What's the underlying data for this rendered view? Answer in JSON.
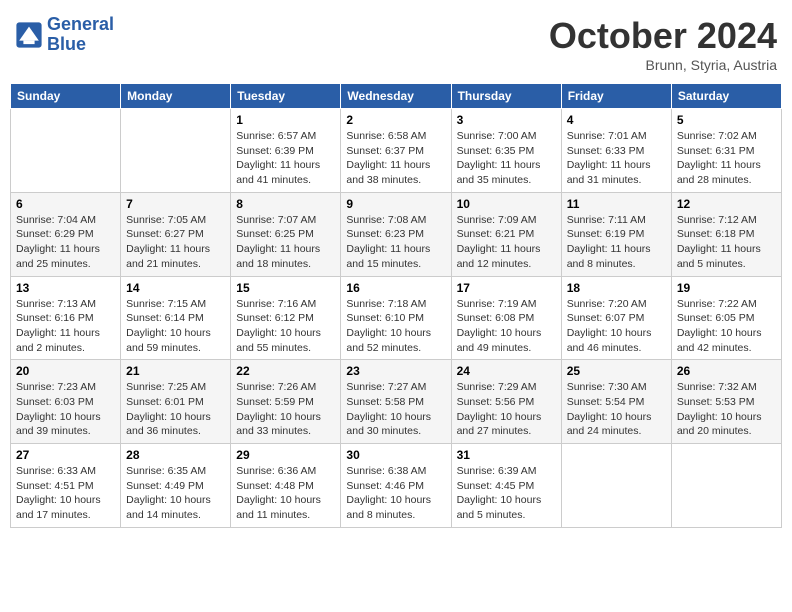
{
  "header": {
    "logo_text_general": "General",
    "logo_text_blue": "Blue",
    "month": "October 2024",
    "location": "Brunn, Styria, Austria"
  },
  "weekdays": [
    "Sunday",
    "Monday",
    "Tuesday",
    "Wednesday",
    "Thursday",
    "Friday",
    "Saturday"
  ],
  "weeks": [
    [
      null,
      null,
      {
        "day": "1",
        "sunrise": "6:57 AM",
        "sunset": "6:39 PM",
        "daylight": "11 hours and 41 minutes."
      },
      {
        "day": "2",
        "sunrise": "6:58 AM",
        "sunset": "6:37 PM",
        "daylight": "11 hours and 38 minutes."
      },
      {
        "day": "3",
        "sunrise": "7:00 AM",
        "sunset": "6:35 PM",
        "daylight": "11 hours and 35 minutes."
      },
      {
        "day": "4",
        "sunrise": "7:01 AM",
        "sunset": "6:33 PM",
        "daylight": "11 hours and 31 minutes."
      },
      {
        "day": "5",
        "sunrise": "7:02 AM",
        "sunset": "6:31 PM",
        "daylight": "11 hours and 28 minutes."
      }
    ],
    [
      {
        "day": "6",
        "sunrise": "7:04 AM",
        "sunset": "6:29 PM",
        "daylight": "11 hours and 25 minutes."
      },
      {
        "day": "7",
        "sunrise": "7:05 AM",
        "sunset": "6:27 PM",
        "daylight": "11 hours and 21 minutes."
      },
      {
        "day": "8",
        "sunrise": "7:07 AM",
        "sunset": "6:25 PM",
        "daylight": "11 hours and 18 minutes."
      },
      {
        "day": "9",
        "sunrise": "7:08 AM",
        "sunset": "6:23 PM",
        "daylight": "11 hours and 15 minutes."
      },
      {
        "day": "10",
        "sunrise": "7:09 AM",
        "sunset": "6:21 PM",
        "daylight": "11 hours and 12 minutes."
      },
      {
        "day": "11",
        "sunrise": "7:11 AM",
        "sunset": "6:19 PM",
        "daylight": "11 hours and 8 minutes."
      },
      {
        "day": "12",
        "sunrise": "7:12 AM",
        "sunset": "6:18 PM",
        "daylight": "11 hours and 5 minutes."
      }
    ],
    [
      {
        "day": "13",
        "sunrise": "7:13 AM",
        "sunset": "6:16 PM",
        "daylight": "11 hours and 2 minutes."
      },
      {
        "day": "14",
        "sunrise": "7:15 AM",
        "sunset": "6:14 PM",
        "daylight": "10 hours and 59 minutes."
      },
      {
        "day": "15",
        "sunrise": "7:16 AM",
        "sunset": "6:12 PM",
        "daylight": "10 hours and 55 minutes."
      },
      {
        "day": "16",
        "sunrise": "7:18 AM",
        "sunset": "6:10 PM",
        "daylight": "10 hours and 52 minutes."
      },
      {
        "day": "17",
        "sunrise": "7:19 AM",
        "sunset": "6:08 PM",
        "daylight": "10 hours and 49 minutes."
      },
      {
        "day": "18",
        "sunrise": "7:20 AM",
        "sunset": "6:07 PM",
        "daylight": "10 hours and 46 minutes."
      },
      {
        "day": "19",
        "sunrise": "7:22 AM",
        "sunset": "6:05 PM",
        "daylight": "10 hours and 42 minutes."
      }
    ],
    [
      {
        "day": "20",
        "sunrise": "7:23 AM",
        "sunset": "6:03 PM",
        "daylight": "10 hours and 39 minutes."
      },
      {
        "day": "21",
        "sunrise": "7:25 AM",
        "sunset": "6:01 PM",
        "daylight": "10 hours and 36 minutes."
      },
      {
        "day": "22",
        "sunrise": "7:26 AM",
        "sunset": "5:59 PM",
        "daylight": "10 hours and 33 minutes."
      },
      {
        "day": "23",
        "sunrise": "7:27 AM",
        "sunset": "5:58 PM",
        "daylight": "10 hours and 30 minutes."
      },
      {
        "day": "24",
        "sunrise": "7:29 AM",
        "sunset": "5:56 PM",
        "daylight": "10 hours and 27 minutes."
      },
      {
        "day": "25",
        "sunrise": "7:30 AM",
        "sunset": "5:54 PM",
        "daylight": "10 hours and 24 minutes."
      },
      {
        "day": "26",
        "sunrise": "7:32 AM",
        "sunset": "5:53 PM",
        "daylight": "10 hours and 20 minutes."
      }
    ],
    [
      {
        "day": "27",
        "sunrise": "6:33 AM",
        "sunset": "4:51 PM",
        "daylight": "10 hours and 17 minutes."
      },
      {
        "day": "28",
        "sunrise": "6:35 AM",
        "sunset": "4:49 PM",
        "daylight": "10 hours and 14 minutes."
      },
      {
        "day": "29",
        "sunrise": "6:36 AM",
        "sunset": "4:48 PM",
        "daylight": "10 hours and 11 minutes."
      },
      {
        "day": "30",
        "sunrise": "6:38 AM",
        "sunset": "4:46 PM",
        "daylight": "10 hours and 8 minutes."
      },
      {
        "day": "31",
        "sunrise": "6:39 AM",
        "sunset": "4:45 PM",
        "daylight": "10 hours and 5 minutes."
      },
      null,
      null
    ]
  ]
}
